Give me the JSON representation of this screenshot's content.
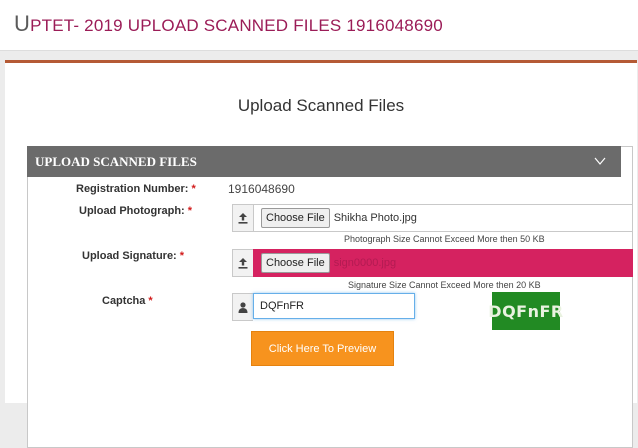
{
  "header": {
    "title_initial": "U",
    "title_rest": "PTET- 2019 UPLOAD SCANNED FILES 1916048690"
  },
  "page": {
    "title": "Upload Scanned Files"
  },
  "panel": {
    "title": "UPLOAD SCANNED FILES",
    "toggle_icon": "chevron-down-icon",
    "required_marker": "*",
    "registration": {
      "label": "Registration Number:",
      "value": "1916048690"
    },
    "photo": {
      "label": "Upload Photograph:",
      "icon": "upload-icon",
      "button": "Choose File",
      "file": "Shikha Photo.jpg",
      "hint": "Photograph Size Cannot Exceed More then 50 KB"
    },
    "signature": {
      "label": "Upload Signature:",
      "icon": "upload-icon",
      "button": "Choose File",
      "file": "sign0000.jpg",
      "hint": "Signature Size Cannot Exceed More then 20 KB",
      "highlight_color": "#d52260"
    },
    "captcha": {
      "label": "Captcha",
      "icon": "user-icon",
      "value": "DQFnFR",
      "image_text": "DQFnFR"
    },
    "preview_button": "Click Here To Preview"
  },
  "colors": {
    "title": "#9b1c57",
    "accent_line": "#b55a35",
    "panel_header": "#6b6b6b",
    "button": "#f7931e",
    "captcha_bg": "#228a23"
  }
}
